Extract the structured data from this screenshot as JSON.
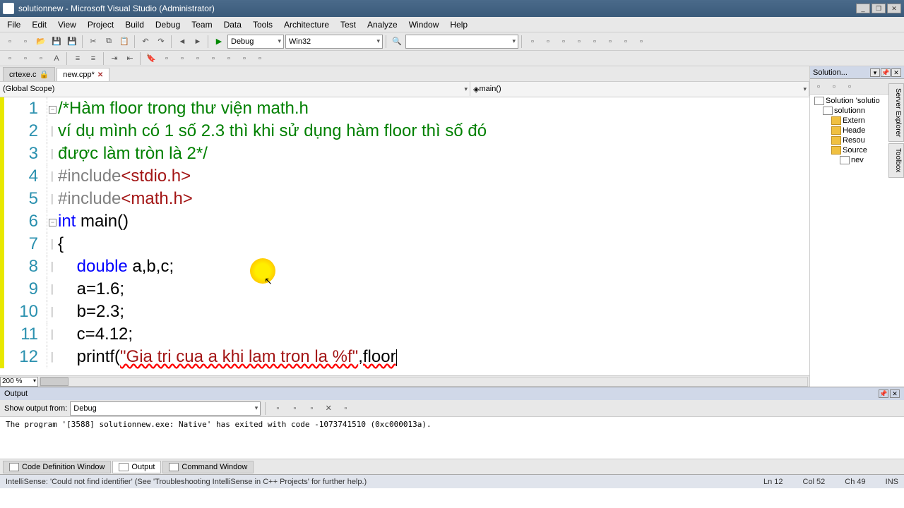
{
  "title": "solutionnew - Microsoft Visual Studio (Administrator)",
  "menu": [
    "File",
    "Edit",
    "View",
    "Project",
    "Build",
    "Debug",
    "Team",
    "Data",
    "Tools",
    "Architecture",
    "Test",
    "Analyze",
    "Window",
    "Help"
  ],
  "toolbar": {
    "config": "Debug",
    "platform": "Win32"
  },
  "tabs": [
    {
      "label": "crtexe.c",
      "locked": true,
      "active": false
    },
    {
      "label": "new.cpp*",
      "locked": false,
      "active": true
    }
  ],
  "scope": {
    "left": "(Global Scope)",
    "right": "main()"
  },
  "code": {
    "lines": [
      {
        "n": 1,
        "fold": "box",
        "segments": [
          {
            "t": "/*Hàm floor trong thư viện math.h",
            "cls": "comment"
          }
        ]
      },
      {
        "n": 2,
        "segments": [
          {
            "t": "ví dụ mình có 1 số 2.3 thì khi sử dụng hàm floor thì số đó",
            "cls": "comment"
          }
        ]
      },
      {
        "n": 3,
        "segments": [
          {
            "t": "được làm tròn là 2*/",
            "cls": "comment"
          }
        ]
      },
      {
        "n": 4,
        "segments": [
          {
            "t": "#include",
            "cls": "preproc"
          },
          {
            "t": "<stdio.h>",
            "cls": "string"
          }
        ]
      },
      {
        "n": 5,
        "segments": [
          {
            "t": "#include",
            "cls": "preproc"
          },
          {
            "t": "<math.h>",
            "cls": "string"
          }
        ]
      },
      {
        "n": 6,
        "fold": "box",
        "segments": [
          {
            "t": "int",
            "cls": "keyword"
          },
          {
            "t": " main()",
            "cls": ""
          }
        ]
      },
      {
        "n": 7,
        "segments": [
          {
            "t": "{",
            "cls": ""
          }
        ]
      },
      {
        "n": 8,
        "segments": [
          {
            "t": "    ",
            "cls": ""
          },
          {
            "t": "double",
            "cls": "keyword"
          },
          {
            "t": " a,b,c;",
            "cls": ""
          }
        ]
      },
      {
        "n": 9,
        "segments": [
          {
            "t": "    a=1.6;",
            "cls": ""
          }
        ]
      },
      {
        "n": 10,
        "segments": [
          {
            "t": "    b=2.3;",
            "cls": ""
          }
        ]
      },
      {
        "n": 11,
        "segments": [
          {
            "t": "    c=4.12;",
            "cls": ""
          }
        ]
      },
      {
        "n": 12,
        "segments": [
          {
            "t": "    printf(",
            "cls": ""
          },
          {
            "t": "\"Gia tri cua a khi lam tron la %f\"",
            "cls": "string err-underline"
          },
          {
            "t": ",floor",
            "cls": "err-underline"
          }
        ]
      }
    ]
  },
  "zoom": "200 %",
  "solution": {
    "title": "Solution...",
    "root": "Solution 'solutio",
    "project": "solutionn",
    "folders": [
      "Extern",
      "Heade",
      "Resou",
      "Source"
    ],
    "files": [
      "nev"
    ]
  },
  "output": {
    "title": "Output",
    "show_from_label": "Show output from:",
    "show_from": "Debug",
    "text": "The program '[3588] solutionnew.exe: Native' has exited with code -1073741510 (0xc000013a)."
  },
  "bottom_tabs": [
    "Code Definition Window",
    "Output",
    "Command Window"
  ],
  "status": {
    "msg": "IntelliSense: 'Could not find identifier' (See 'Troubleshooting IntelliSense in C++ Projects' for further help.)",
    "ln": "Ln 12",
    "col": "Col 52",
    "ch": "Ch 49",
    "ins": "INS"
  },
  "vert_tabs": [
    "Server Explorer",
    "Toolbox"
  ]
}
